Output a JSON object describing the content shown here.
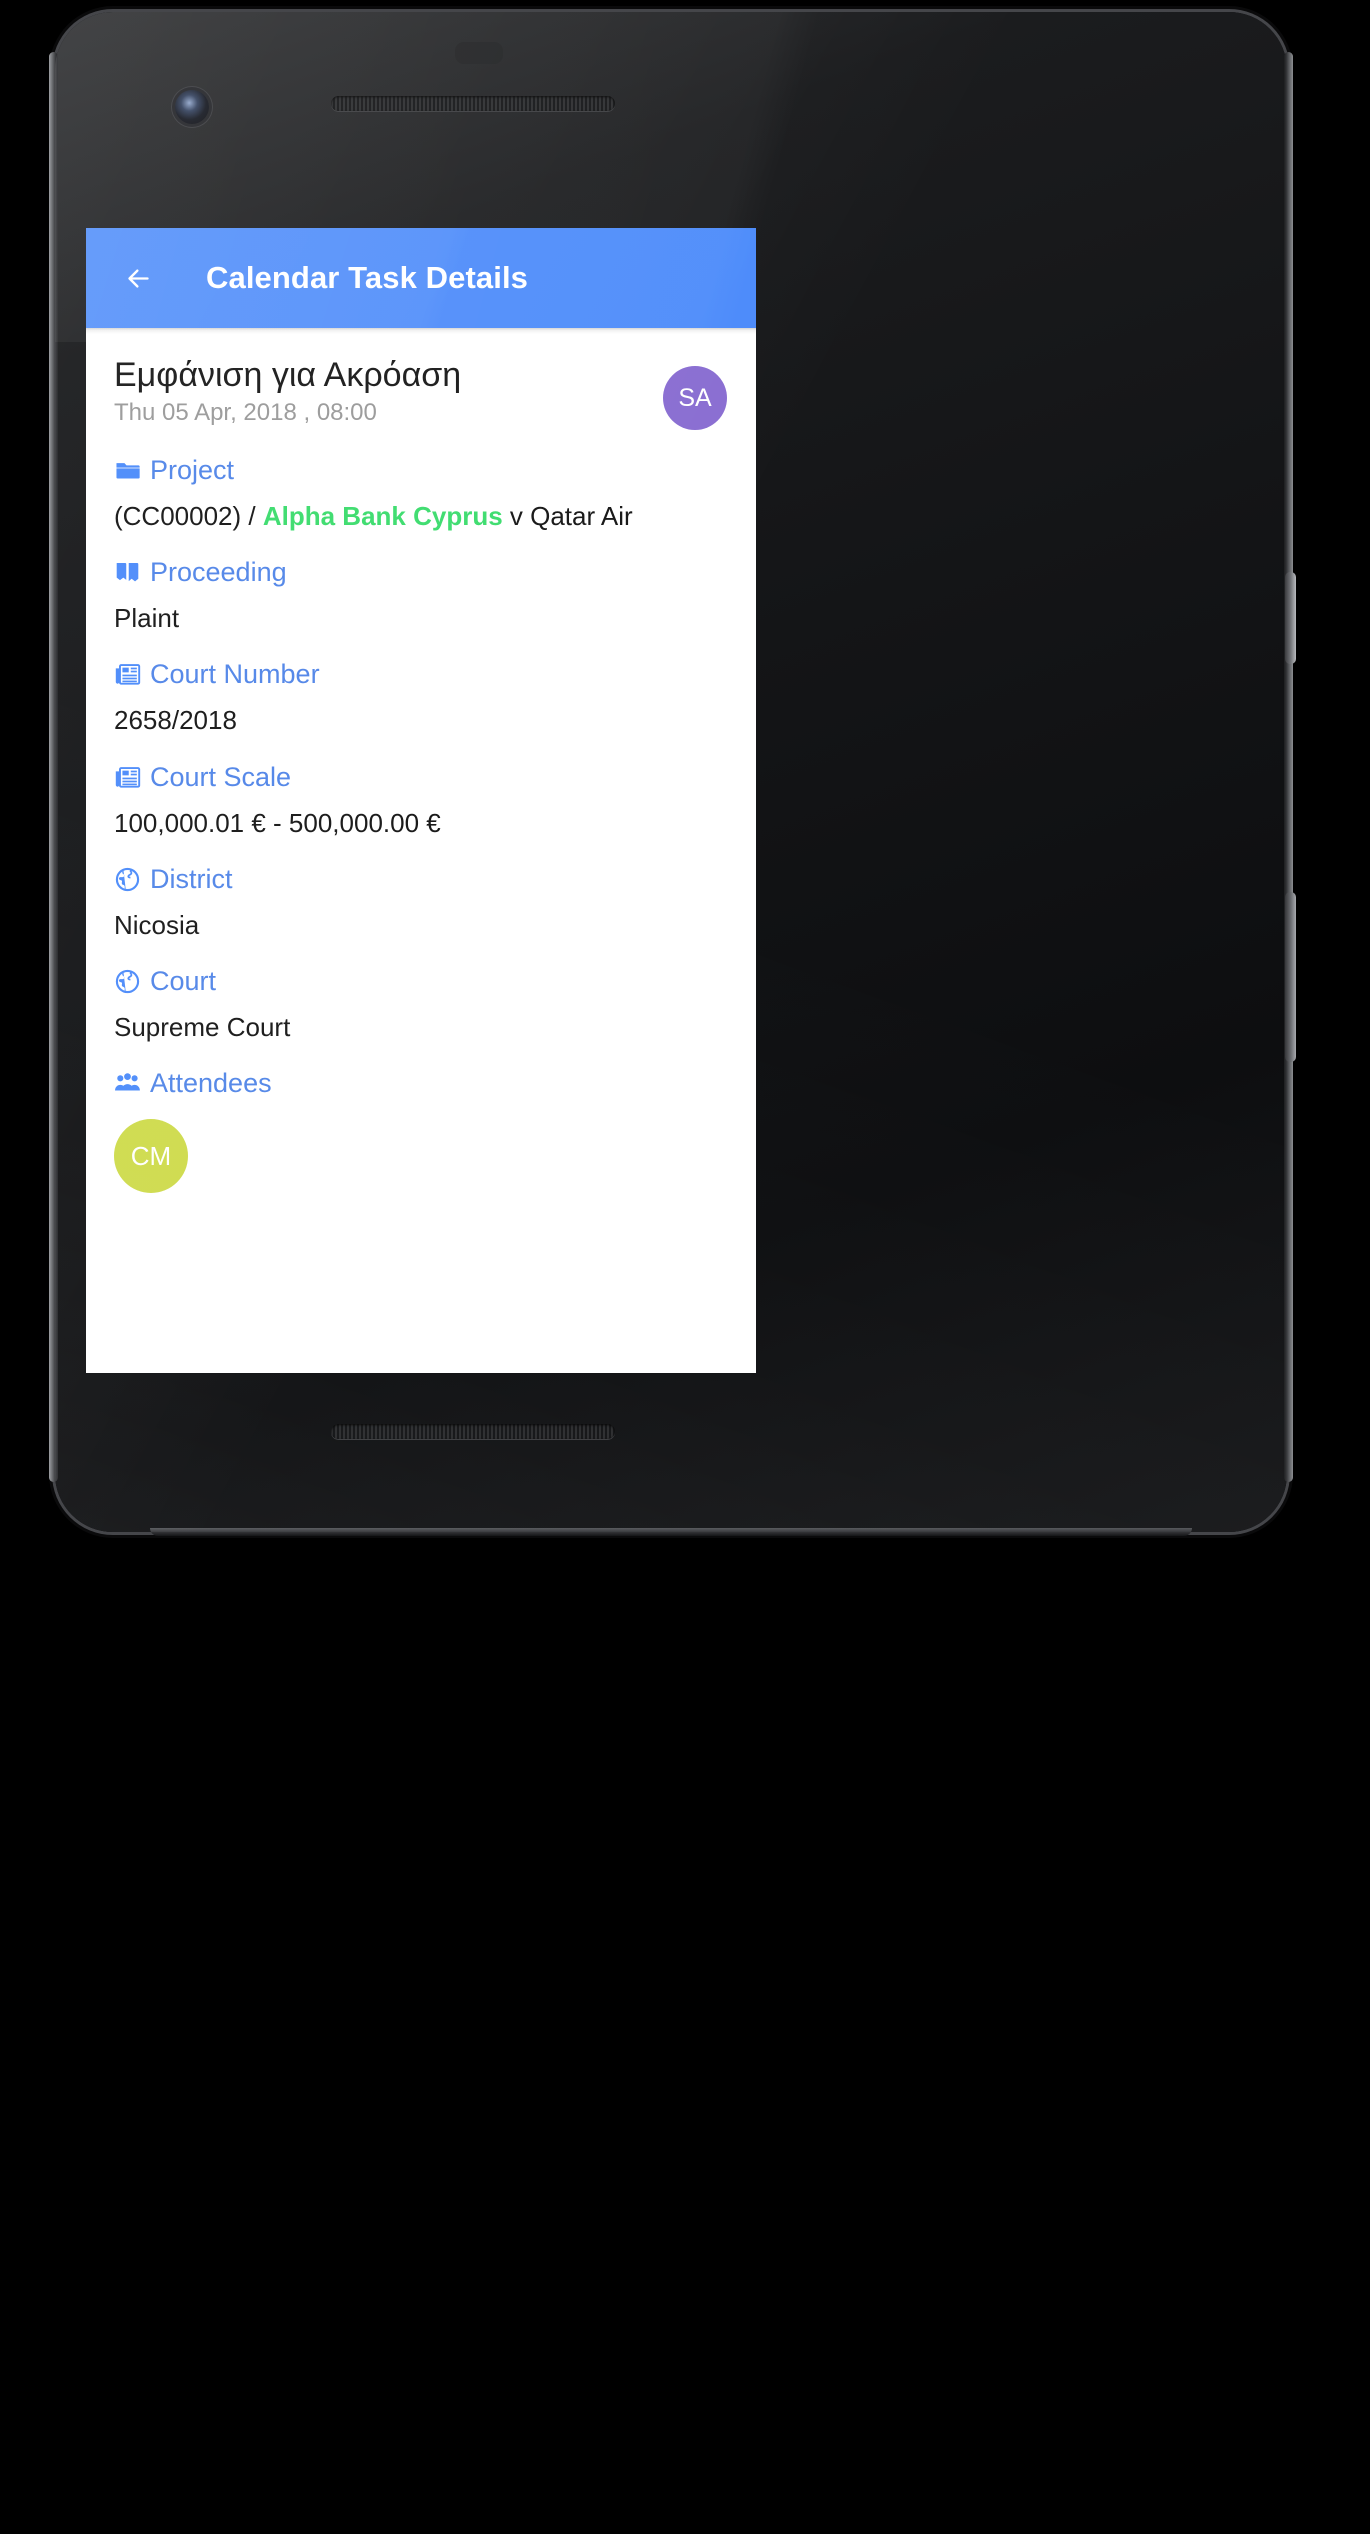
{
  "device": {
    "camera_icon": "front-camera",
    "earpiece_icon": "earpiece-speaker",
    "sensor_icon": "proximity-sensor",
    "bottom_speaker_icon": "bottom-speaker"
  },
  "appbar": {
    "back_icon": "arrow-left-icon",
    "title": "Calendar Task Details",
    "background": "#4c8bfa",
    "title_color": "#ffffff"
  },
  "task": {
    "title": "Εμφάνιση για Ακρόαση",
    "datetime": "Thu 05 Apr, 2018 , 08:00",
    "owner_avatar": {
      "initials": "SA",
      "color": "#8a6ed2"
    }
  },
  "fields": [
    {
      "label": "Project",
      "icon": "folder-icon",
      "value_prefix": "(CC00002) / ",
      "value_highlight": "Alpha Bank Cyprus",
      "value_suffix": " v Qatar Air",
      "highlight_color": "#3ddc6e"
    },
    {
      "label": "Proceeding",
      "icon": "book-open-icon",
      "value": "Plaint"
    },
    {
      "label": "Court Number",
      "icon": "newspaper-icon",
      "value": "2658/2018"
    },
    {
      "label": "Court Scale",
      "icon": "newspaper-icon",
      "value": "100,000.01 € - 500,000.00 €"
    },
    {
      "label": "District",
      "icon": "globe-icon",
      "value": "Nicosia"
    },
    {
      "label": "Court",
      "icon": "globe-icon",
      "value": "Supreme Court"
    }
  ],
  "attendees": {
    "label": "Attendees",
    "icon": "people-icon",
    "list": [
      {
        "initials": "CM",
        "color": "#cedb4c"
      }
    ]
  },
  "colors": {
    "label_blue": "#5286e8",
    "accent_blue": "#4c8bfa",
    "value_black": "#171717",
    "date_gray": "#9a9a9a"
  }
}
